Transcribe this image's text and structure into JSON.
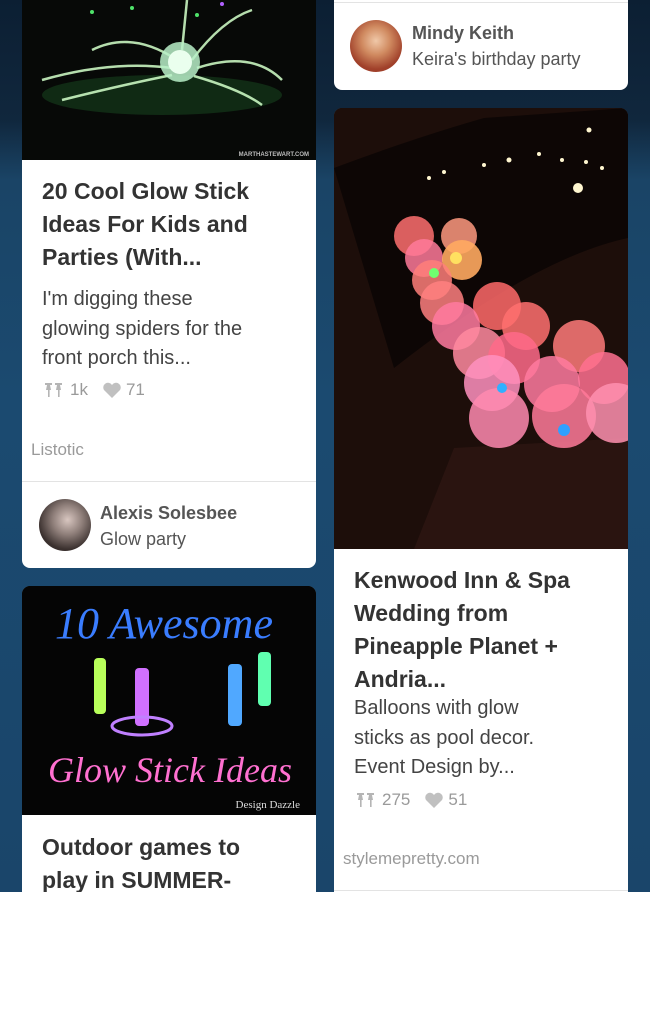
{
  "pins": [
    {
      "title": "20 Cool Glow Stick Ideas For Kids and Parties (With...",
      "title_lines": [
        "20 Cool Glow Stick",
        "Ideas For Kids and",
        "Parties (With..."
      ],
      "description_lines": [
        "I'm digging these",
        "glowing spiders for the",
        "front porch this..."
      ],
      "repins": "1k",
      "likes": "71",
      "source": "Listotic",
      "image_watermark": "MARTHASTEWART.COM",
      "pinner": {
        "name": "Alexis Solesbee",
        "board": "Glow party"
      }
    },
    {
      "pinner": {
        "name": "Mindy Keith",
        "board": "Keira's birthday party"
      }
    },
    {
      "title_lines": [
        "Kenwood Inn & Spa",
        "Wedding from",
        "Pineapple Planet +",
        "Andria..."
      ],
      "description_lines": [
        "Balloons with glow",
        "sticks as pool decor.",
        "Event Design by..."
      ],
      "repins": "275",
      "likes": "51",
      "source": "stylemepretty.com"
    },
    {
      "image_text": {
        "line1": "10 Awesome",
        "line2": "Glow Stick Ideas",
        "credit": "Design Dazzle"
      },
      "title_lines": [
        "Outdoor games to",
        "play in SUMMER-"
      ]
    }
  ],
  "icons": {
    "repin": "pin-icon",
    "like": "heart-icon"
  },
  "colors": {
    "background": "#1b4a70",
    "card": "#ffffff",
    "meta_text": "#9a9a9a"
  }
}
